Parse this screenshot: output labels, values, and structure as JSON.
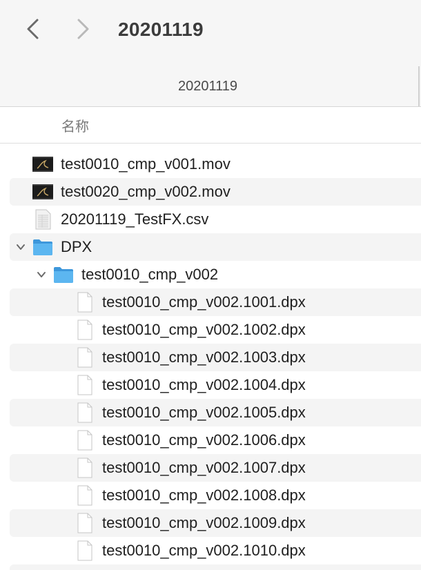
{
  "window": {
    "title": "20201119"
  },
  "tab": {
    "label": "20201119"
  },
  "columns": {
    "name": "名称"
  },
  "files": [
    {
      "name": "test0010_cmp_v001.mov",
      "kind": "movie",
      "icon": "movie-icon",
      "depth": 0
    },
    {
      "name": "test0020_cmp_v002.mov",
      "kind": "movie",
      "icon": "movie-icon",
      "depth": 0
    },
    {
      "name": "20201119_TestFX.csv",
      "kind": "csv",
      "icon": "csv-document-icon",
      "depth": 0
    },
    {
      "name": "DPX",
      "kind": "folder",
      "icon": "folder-icon",
      "depth": 0,
      "expanded": true
    },
    {
      "name": "test0010_cmp_v002",
      "kind": "folder",
      "icon": "folder-icon",
      "depth": 1,
      "expanded": true
    },
    {
      "name": "test0010_cmp_v002.1001.dpx",
      "kind": "file",
      "icon": "document-icon",
      "depth": 2
    },
    {
      "name": "test0010_cmp_v002.1002.dpx",
      "kind": "file",
      "icon": "document-icon",
      "depth": 2
    },
    {
      "name": "test0010_cmp_v002.1003.dpx",
      "kind": "file",
      "icon": "document-icon",
      "depth": 2
    },
    {
      "name": "test0010_cmp_v002.1004.dpx",
      "kind": "file",
      "icon": "document-icon",
      "depth": 2
    },
    {
      "name": "test0010_cmp_v002.1005.dpx",
      "kind": "file",
      "icon": "document-icon",
      "depth": 2
    },
    {
      "name": "test0010_cmp_v002.1006.dpx",
      "kind": "file",
      "icon": "document-icon",
      "depth": 2
    },
    {
      "name": "test0010_cmp_v002.1007.dpx",
      "kind": "file",
      "icon": "document-icon",
      "depth": 2
    },
    {
      "name": "test0010_cmp_v002.1008.dpx",
      "kind": "file",
      "icon": "document-icon",
      "depth": 2
    },
    {
      "name": "test0010_cmp_v002.1009.dpx",
      "kind": "file",
      "icon": "document-icon",
      "depth": 2
    },
    {
      "name": "test0010_cmp_v002.1010.dpx",
      "kind": "file",
      "icon": "document-icon",
      "depth": 2
    }
  ],
  "colors": {
    "toolbar_bg": "#f6f6f6",
    "stripe": "#f4f4f4",
    "folder_blue": "#4aa8e8"
  }
}
